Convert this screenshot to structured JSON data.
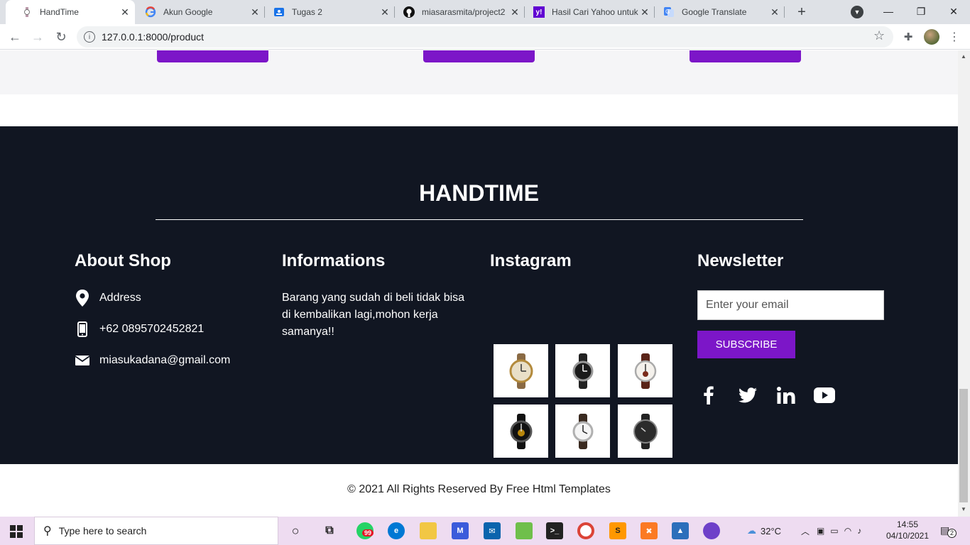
{
  "browser": {
    "tabs": [
      {
        "title": "HandTime",
        "icon": "watch-favicon-icon",
        "active": true
      },
      {
        "title": "Akun Google",
        "icon": "google-g-icon",
        "active": false
      },
      {
        "title": "Tugas 2",
        "icon": "classroom-icon",
        "active": false
      },
      {
        "title": "miasarasmita/project2",
        "icon": "github-icon",
        "active": false
      },
      {
        "title": "Hasil Cari Yahoo untuk",
        "icon": "yahoo-icon",
        "active": false
      },
      {
        "title": "Google Translate",
        "icon": "google-translate-icon",
        "active": false
      }
    ],
    "url": "127.0.0.1:8000/product"
  },
  "footer": {
    "brand": "HANDTIME",
    "about": {
      "title": "About Shop",
      "address": "Address",
      "phone": "+62 0895702452821",
      "email": "miasukadana@gmail.com"
    },
    "informations": {
      "title": "Informations",
      "text": "Barang yang sudah di beli tidak bisa di kembalikan lagi,mohon kerja samanya!!"
    },
    "instagram": {
      "title": "Instagram",
      "images": [
        "watch-image-1",
        "watch-image-2",
        "watch-image-3",
        "watch-image-4",
        "watch-image-5",
        "watch-image-6"
      ]
    },
    "newsletter": {
      "title": "Newsletter",
      "email_placeholder": "Enter your email",
      "subscribe_label": "SUBSCRIBE",
      "social": [
        "facebook-icon",
        "twitter-icon",
        "linkedin-icon",
        "youtube-icon"
      ]
    },
    "copyright": "© 2021 All Rights Reserved By Free Html Templates"
  },
  "taskbar": {
    "search_placeholder": "Type here to search",
    "weather": "32°C",
    "time": "14:55",
    "date": "04/10/2021",
    "notification_count": "2",
    "whatsapp_badge": "99"
  },
  "colors": {
    "accent": "#7c16c8",
    "footer_bg": "#111622"
  }
}
